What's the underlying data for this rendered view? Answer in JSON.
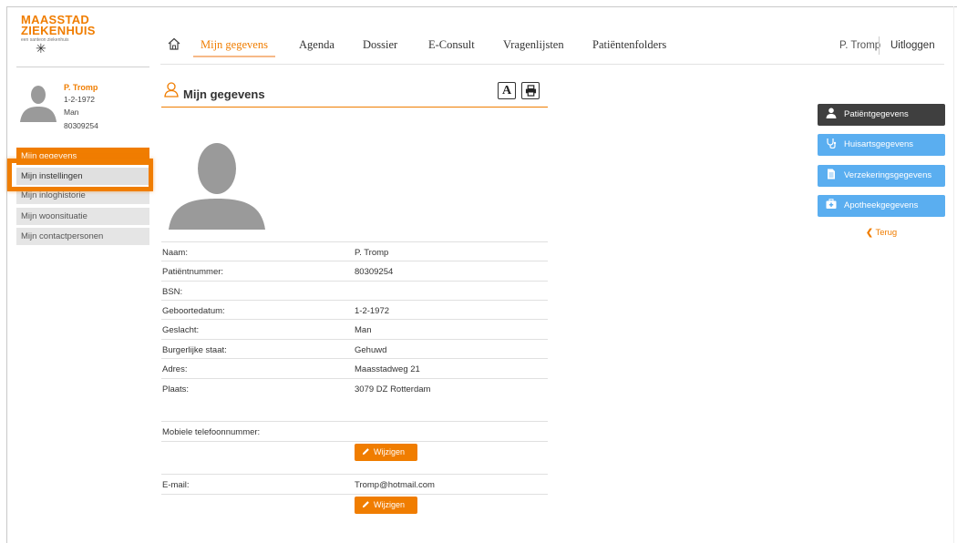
{
  "logo": {
    "line1": "MAASSTAD",
    "line2": "ZIEKENHUIS",
    "tagline": "een santeon ziekenhuis"
  },
  "nav": {
    "items": [
      "Mijn gegevens",
      "Agenda",
      "Dossier",
      "E-Consult",
      "Vragenlijsten",
      "Patiëntenfolders"
    ],
    "active": "Mijn gegevens"
  },
  "user": {
    "name": "P. Tromp",
    "logout": "Uitloggen"
  },
  "profile": {
    "name": "P. Tromp",
    "birthdate": "1-2-1972",
    "gender": "Man",
    "number": "80309254"
  },
  "sidebar": {
    "items": [
      "Mijn gegevens",
      "Mijn instellingen",
      "Mijn inloghistorie",
      "Mijn woonsituatie",
      "Mijn contactpersonen"
    ]
  },
  "section": {
    "title": "Mijn gegevens",
    "font_icon": "A"
  },
  "fields": [
    {
      "label": "Naam:",
      "value": "P. Tromp"
    },
    {
      "label": "Patiëntnummer:",
      "value": "80309254"
    },
    {
      "label": "BSN:",
      "value": ""
    },
    {
      "label": "Geboortedatum:",
      "value": "1-2-1972"
    },
    {
      "label": "Geslacht:",
      "value": "Man"
    },
    {
      "label": "Burgerlijke staat:",
      "value": "Gehuwd"
    },
    {
      "label": "Adres:",
      "value": "Maasstadweg 21"
    },
    {
      "label": "Plaats:",
      "value": "3079 DZ  Rotterdam"
    }
  ],
  "mobile": {
    "label": "Mobiele telefoonnummer:",
    "value": "",
    "edit": "Wijzigen"
  },
  "email": {
    "label": "E-mail:",
    "value": "Tromp@hotmail.com",
    "edit": "Wijzigen"
  },
  "right_buttons": [
    "Patiëntgegevens",
    "Huisartsgegevens",
    "Verzekeringsgegevens",
    "Apotheekgegevens"
  ],
  "back": "Terug",
  "colors": {
    "brand": "#f07d00",
    "blue": "#5aaef0",
    "dark": "#3f3f3f"
  }
}
